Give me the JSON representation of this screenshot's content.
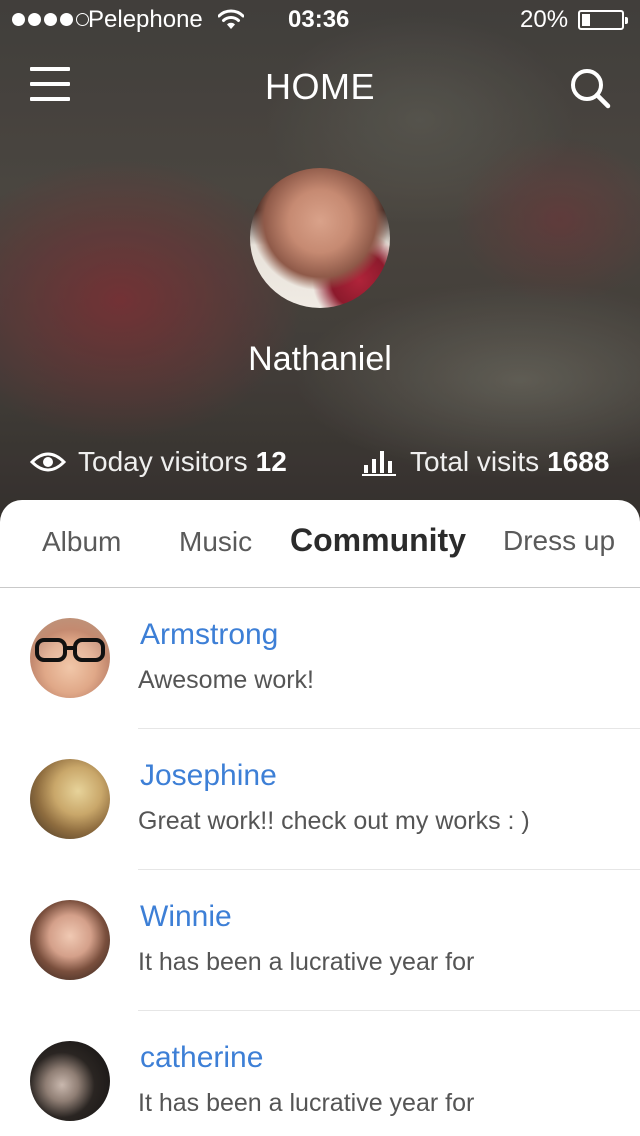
{
  "status_bar": {
    "carrier": "Pelephone",
    "time": "03:36",
    "battery": "20%",
    "battery_level": 0.2,
    "signal_bars": 4,
    "signal_total": 5
  },
  "nav": {
    "title": "HOME",
    "menu_icon": "hamburger-menu-icon",
    "search_icon": "search-icon"
  },
  "profile": {
    "name": "Nathaniel"
  },
  "stats": {
    "today_label": "Today visitors",
    "today_value": "12",
    "total_label": "Total visits",
    "total_value": "1688"
  },
  "tabs": [
    {
      "label": "Album",
      "active": false
    },
    {
      "label": "Music",
      "active": false
    },
    {
      "label": "Community",
      "active": true
    },
    {
      "label": "Dress up",
      "active": false
    }
  ],
  "comments": [
    {
      "name": "Armstrong",
      "message": "Awesome work!"
    },
    {
      "name": "Josephine",
      "message": "Great work!! check out my works : )"
    },
    {
      "name": "Winnie",
      "message": "It has been a lucrative year for"
    },
    {
      "name": "catherine",
      "message": "It has been a lucrative year for"
    }
  ],
  "colors": {
    "accent_link": "#3d7fd6",
    "active_tab": "#2b2b2b"
  }
}
